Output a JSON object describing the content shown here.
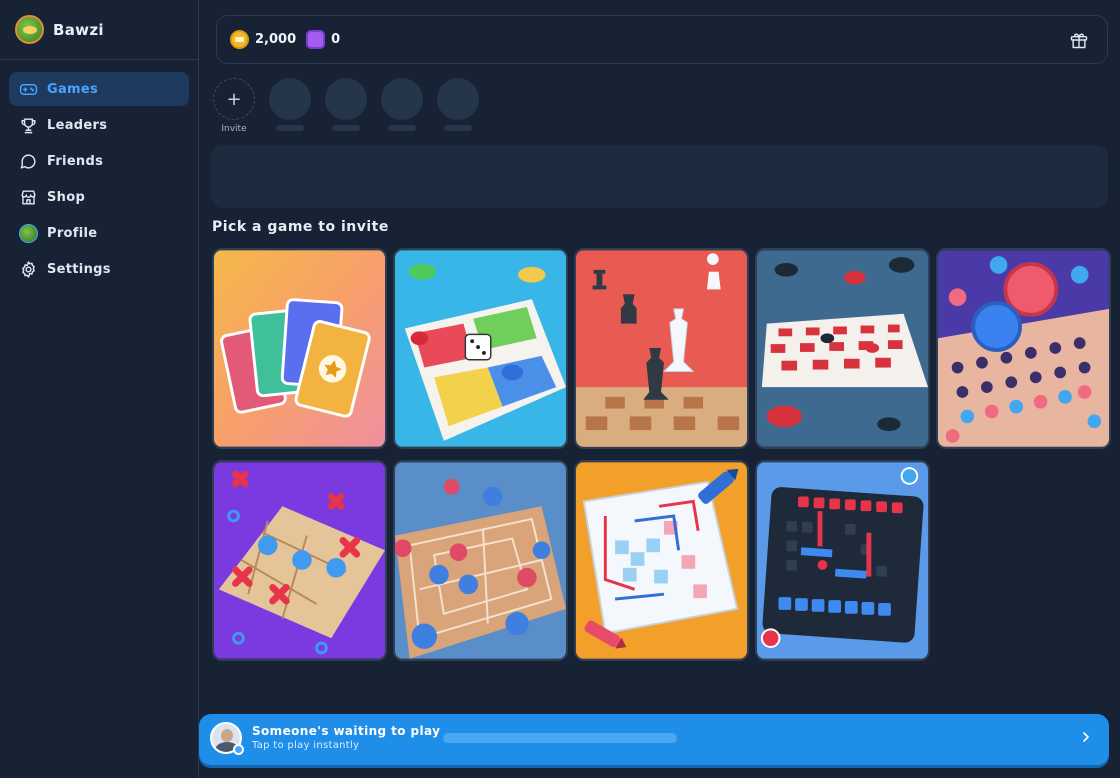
{
  "brand": {
    "name": "Bawzi",
    "avatar_icon": "frog-avatar-icon"
  },
  "sidebar": {
    "items": [
      {
        "label": "Games",
        "icon": "gamepad-icon",
        "active": true
      },
      {
        "label": "Leaders",
        "icon": "trophy-icon",
        "active": false
      },
      {
        "label": "Friends",
        "icon": "chat-bubble-icon",
        "active": false
      },
      {
        "label": "Shop",
        "icon": "store-icon",
        "active": false
      },
      {
        "label": "Profile",
        "icon": "avatar-icon",
        "active": false
      },
      {
        "label": "Settings",
        "icon": "gear-icon",
        "active": false
      }
    ]
  },
  "currency": {
    "coins": "2,000",
    "gems": "0"
  },
  "invite": {
    "label": "Invite"
  },
  "section": {
    "title": "Pick a game to invite"
  },
  "games": [
    {
      "icon": "cards-game-icon"
    },
    {
      "icon": "ludo-game-icon"
    },
    {
      "icon": "chess-game-icon"
    },
    {
      "icon": "checkers-game-icon"
    },
    {
      "icon": "connect-four-game-icon"
    },
    {
      "icon": "tic-tac-toe-game-icon"
    },
    {
      "icon": "nine-mens-morris-game-icon"
    },
    {
      "icon": "dots-and-boxes-game-icon"
    },
    {
      "icon": "battleship-game-icon"
    }
  ],
  "waiting": {
    "title": "Someone's waiting to play",
    "subtitle": "Tap to play instantly"
  },
  "colors": {
    "background": "#172334",
    "accent": "#4aa3ff",
    "active_nav": "#1e3a5f",
    "waitbar": "#1f8ee8"
  }
}
